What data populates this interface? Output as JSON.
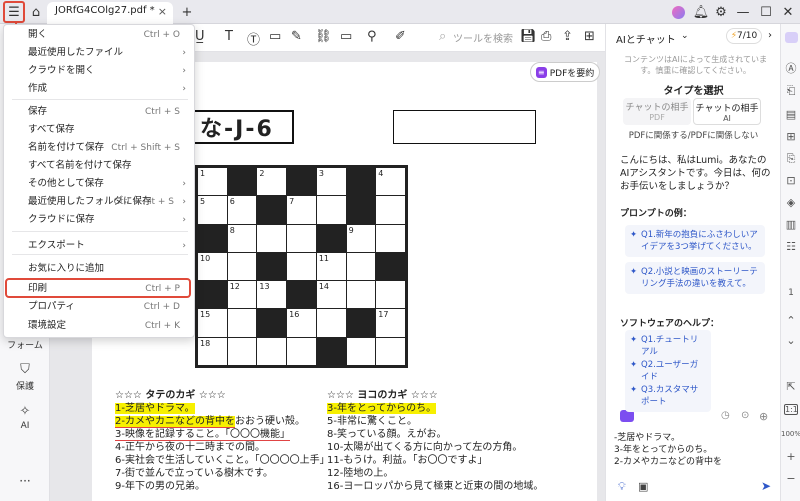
{
  "titlebar": {
    "tab_title": "JORfG4COlg27.pdf *",
    "tab_close": "×",
    "new_tab": "+",
    "window_min": "—",
    "window_max": "☐",
    "window_close": "✕"
  },
  "toolbar": {
    "search_placeholder": "ツールを検索"
  },
  "menu": {
    "items": [
      {
        "label": "開く",
        "shortcut": "Ctrl + O",
        "arrow": ""
      },
      {
        "label": "最近使用したファイル",
        "shortcut": "",
        "arrow": "›"
      },
      {
        "label": "クラウドを開く",
        "shortcut": "",
        "arrow": "›"
      },
      {
        "label": "作成",
        "shortcut": "",
        "arrow": "›"
      },
      {
        "label": "保存",
        "shortcut": "Ctrl + S",
        "arrow": ""
      },
      {
        "label": "すべて保存",
        "shortcut": "",
        "arrow": ""
      },
      {
        "label": "名前を付けて保存",
        "shortcut": "Ctrl + Shift + S",
        "arrow": ""
      },
      {
        "label": "すべて名前を付けて保存",
        "shortcut": "",
        "arrow": ""
      },
      {
        "label": "その他として保存",
        "shortcut": "",
        "arrow": "›"
      },
      {
        "label": "最近使用したフォルダに保存",
        "shortcut": "Ctrl + Alt + S",
        "arrow": "›"
      },
      {
        "label": "クラウドに保存",
        "shortcut": "",
        "arrow": "›"
      },
      {
        "label": "エクスポート",
        "shortcut": "",
        "arrow": "›"
      },
      {
        "label": "お気に入りに追加",
        "shortcut": "",
        "arrow": ""
      },
      {
        "label": "印刷",
        "shortcut": "Ctrl + P",
        "arrow": ""
      },
      {
        "label": "プロパティ",
        "shortcut": "Ctrl + D",
        "arrow": ""
      },
      {
        "label": "環境設定",
        "shortcut": "Ctrl + K",
        "arrow": ""
      }
    ]
  },
  "leftbar": {
    "form": "フォーム",
    "protect": "保護",
    "ai": "AI",
    "more": "···"
  },
  "document": {
    "summarize_button": "PDFを要約",
    "puzzle_title": "な-J-6",
    "grid": [
      [
        {
          "n": "1",
          "b": false
        },
        {
          "n": "",
          "b": true
        },
        {
          "n": "2",
          "b": false
        },
        {
          "n": "",
          "b": true
        },
        {
          "n": "3",
          "b": false
        },
        {
          "n": "",
          "b": true
        },
        {
          "n": "4",
          "b": false
        }
      ],
      [
        {
          "n": "5",
          "b": false
        },
        {
          "n": "6",
          "b": false
        },
        {
          "n": "",
          "b": true
        },
        {
          "n": "7",
          "b": false
        },
        {
          "n": "",
          "b": false
        },
        {
          "n": "",
          "b": true
        },
        {
          "n": "",
          "b": false
        }
      ],
      [
        {
          "n": "",
          "b": true
        },
        {
          "n": "8",
          "b": false
        },
        {
          "n": "",
          "b": false
        },
        {
          "n": "",
          "b": false
        },
        {
          "n": "",
          "b": true
        },
        {
          "n": "9",
          "b": false
        },
        {
          "n": "",
          "b": false
        }
      ],
      [
        {
          "n": "10",
          "b": false
        },
        {
          "n": "",
          "b": false
        },
        {
          "n": "",
          "b": true
        },
        {
          "n": "",
          "b": false
        },
        {
          "n": "11",
          "b": false
        },
        {
          "n": "",
          "b": false
        },
        {
          "n": "",
          "b": true
        }
      ],
      [
        {
          "n": "",
          "b": true
        },
        {
          "n": "12",
          "b": false
        },
        {
          "n": "13",
          "b": false
        },
        {
          "n": "",
          "b": true
        },
        {
          "n": "14",
          "b": false
        },
        {
          "n": "",
          "b": false
        },
        {
          "n": "",
          "b": false
        }
      ],
      [
        {
          "n": "15",
          "b": false
        },
        {
          "n": "",
          "b": false
        },
        {
          "n": "",
          "b": true
        },
        {
          "n": "16",
          "b": false
        },
        {
          "n": "",
          "b": false
        },
        {
          "n": "",
          "b": true
        },
        {
          "n": "17",
          "b": false
        }
      ],
      [
        {
          "n": "18",
          "b": false
        },
        {
          "n": "",
          "b": false
        },
        {
          "n": "",
          "b": false
        },
        {
          "n": "",
          "b": false
        },
        {
          "n": "",
          "b": true
        },
        {
          "n": "",
          "b": false
        },
        {
          "n": "",
          "b": false
        }
      ]
    ],
    "down_header": "☆☆☆ タテのカギ ☆☆☆",
    "down_clues": [
      {
        "text": "1-芝居やドラマ。",
        "style": "hl"
      },
      {
        "text": "2-カメやカニなどの背中をおおう硬い殻。",
        "style": "hl-partial"
      },
      {
        "text": "3-映像を記録すること。「〇〇〇機能」",
        "style": "ul"
      },
      {
        "text": "4-正午から夜の十二時までの間。",
        "style": ""
      },
      {
        "text": "6-実社会で生活していくこと。「〇〇〇〇上手」",
        "style": ""
      },
      {
        "text": "7-街で並んで立っている樹木です。",
        "style": ""
      },
      {
        "text": "9-年下の男の兄弟。",
        "style": ""
      }
    ],
    "down_clue2_hl_part": "2-カメやカニなどの背中を",
    "down_clue2_rest": "おおう硬い殻。",
    "across_header": "☆☆☆ ヨコのカギ ☆☆☆",
    "across_clues": [
      {
        "text": "3-年をとってからのち。",
        "style": "hl"
      },
      {
        "text": "5-非常に驚くこと。",
        "style": ""
      },
      {
        "text": "8-笑っている顔。えがお。",
        "style": ""
      },
      {
        "text": "10-太陽が出てくる方に向かって左の方角。",
        "style": ""
      },
      {
        "text": "11-もうけ。利益。「お〇〇ですよ」",
        "style": ""
      },
      {
        "text": "12-陸地の上。",
        "style": ""
      },
      {
        "text": "16-ヨーロッパから見て極東と近東の間の地域。",
        "style": ""
      }
    ]
  },
  "ai_panel": {
    "title": "AIとチャット",
    "credits": "7/10",
    "disclaimer": "コンテンツはAIによって生成されています。慎重に確認してください。",
    "type_heading": "タイプを選択",
    "option1_title": "チャットの相手",
    "option1_sub": "PDF",
    "option2_title": "チャットの相手",
    "option2_sub": "AI",
    "type_caption": "PDFに関係する/PDFに関係しない",
    "greeting": "こんにちは、私はLumi。あなたのAIアシスタントです。今日は、何のお手伝いをしましょうか？",
    "prompts_heading": "プロンプトの例：",
    "prompts": [
      "Q1.新年の抱負にふさわしいアイデアを3つ挙げてください。",
      "Q2.小説と映画のストーリーテリング手法の違いを教えて。"
    ],
    "help_heading": "ソフトウェアのヘルプ：",
    "help": [
      "Q1.チュートリアル",
      "Q2.ユーザーガイド",
      "Q3.カスタマサポート"
    ],
    "input_text": "-芝居やドラマ。\n3-年をとってからのち。\n2-カメやカニなどの背中を"
  },
  "rightbar": {
    "page_number": "1",
    "zoom": "100%",
    "fit_label": "1:1"
  },
  "colors": {
    "accent_red": "#e04a3a",
    "highlight_yellow": "#f7f000",
    "ai_purple": "#8a3ee8",
    "link_blue": "#2e57c8"
  }
}
